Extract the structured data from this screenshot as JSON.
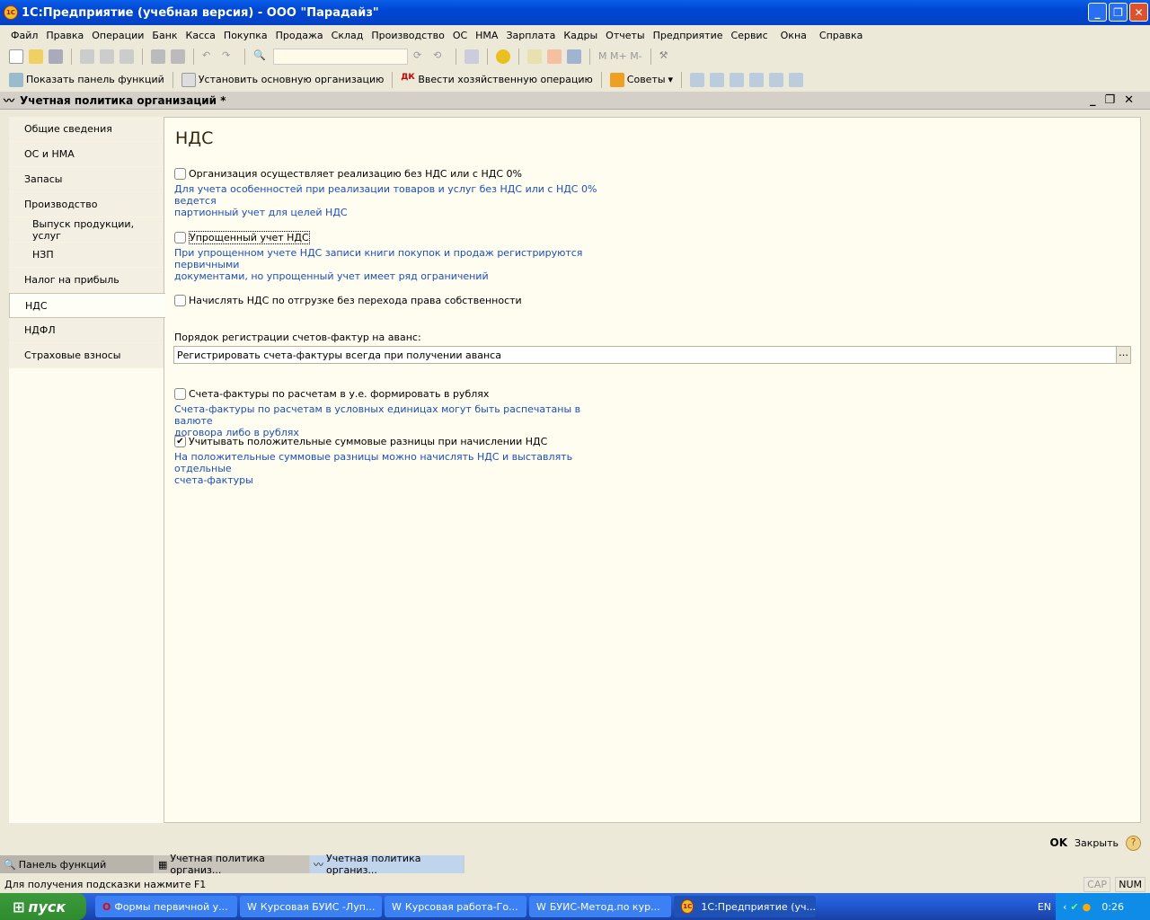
{
  "window": {
    "title": "1С:Предприятие (учебная версия) - ООО \"Парадайз\"",
    "logo": "1С"
  },
  "menu": [
    "Файл",
    "Правка",
    "Операции",
    "Банк",
    "Касса",
    "Покупка",
    "Продажа",
    "Склад",
    "Производство",
    "ОС",
    "НМА",
    "Зарплата",
    "Кадры",
    "Отчеты",
    "Предприятие",
    "Сервис",
    "Окна",
    "Справка"
  ],
  "toolbar2": {
    "show_panel": "Показать панель функций",
    "set_org": "Установить основную организацию",
    "enter_op": "Ввести хозяйственную операцию",
    "tips": "Советы"
  },
  "doc": {
    "title": "Учетная политика организаций *"
  },
  "nav": [
    "Общие сведения",
    "ОС и НМА",
    "Запасы",
    "Производство",
    "Выпуск продукции, услуг",
    "НЗП",
    "Налог на прибыль",
    "НДС",
    "НДФЛ",
    "Страховые взносы"
  ],
  "main": {
    "heading": "НДС",
    "opt1": {
      "label": "Организация осуществляет реализацию без НДС или с НДС 0%",
      "checked": false,
      "hint1": "Для учета особенностей при реализации товаров и услуг без НДС или с НДС 0% ведется",
      "hint2": "партионный учет для целей НДС"
    },
    "opt2": {
      "label": "Упрощенный учет НДС",
      "checked": false,
      "hint1": "При упрощенном учете НДС записи книги покупок и продаж регистрируются первичными",
      "hint2": "документами, но упрощенный учет имеет ряд ограничений"
    },
    "opt3": {
      "label": "Начислять НДС по отгрузке без перехода права собственности",
      "checked": false
    },
    "order_label": "Порядок регистрации счетов-фактур на аванс:",
    "order_value": "Регистрировать счета-фактуры всегда при получении аванса",
    "opt4": {
      "label": "Счета-фактуры по расчетам в у.е. формировать в рублях",
      "checked": false,
      "hint1": "Счета-фактуры по расчетам в условных единицах могут быть распечатаны в валюте",
      "hint2": "договора либо в рублях"
    },
    "opt5": {
      "label": "Учитывать положительные суммовые разницы при начислении НДС",
      "checked": true,
      "hint1": "На положительные суммовые разницы можно начислять НДС и выставлять отдельные",
      "hint2": "счета-фактуры"
    }
  },
  "footer": {
    "ok": "OK",
    "close": "Закрыть",
    "help": "?"
  },
  "wintabs": [
    "Панель функций",
    "Учетная политика организ...",
    "Учетная политика организ..."
  ],
  "status": {
    "text": "Для получения подсказки нажмите F1",
    "cap": "CAP",
    "num": "NUM"
  },
  "taskbar": {
    "start": "пуск",
    "tasks": [
      "Формы первичной у...",
      "Курсовая БУИС -Луп...",
      "Курсовая работа-Го...",
      "БУИС-Метод.по кур...",
      "1С:Предприятие (уч..."
    ],
    "lang": "EN",
    "clock": "0:26"
  }
}
